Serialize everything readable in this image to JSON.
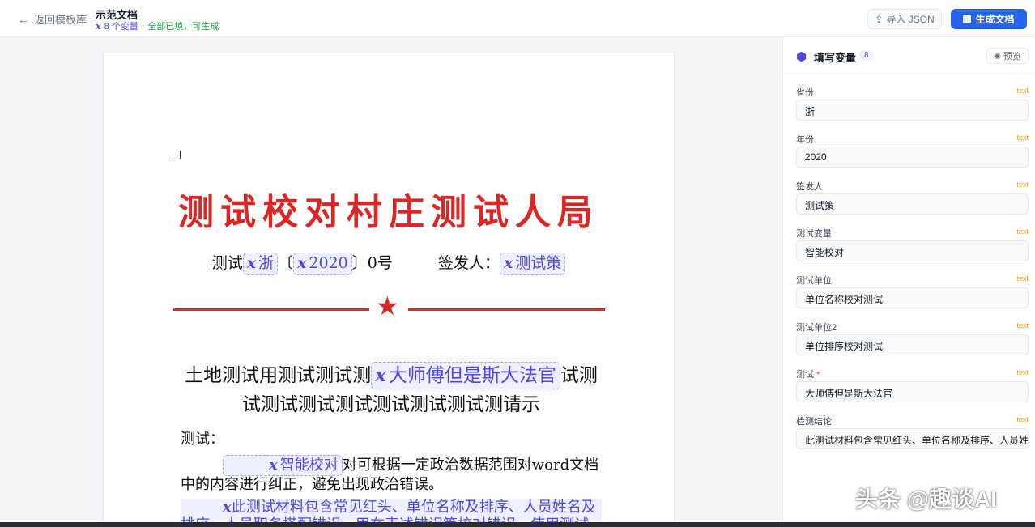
{
  "header": {
    "back_label": "返回模板库",
    "doc_title": "示范文档",
    "var_glyph": "𝒙",
    "var_count": "8 个变量",
    "separator": "·",
    "status": "全部已填，可生成",
    "import_label": "导入 JSON",
    "generate_label": "生成文档"
  },
  "document": {
    "title": "测试校对村庄测试人局",
    "meta_prefix": "测试",
    "province": "浙",
    "bracket_open": "〔",
    "year": "2020",
    "bracket_close": "〕0号",
    "signer_label": "签发人：",
    "signer": "测试策",
    "subject_prefix": "土地测试用测试测试测",
    "subject_var": "大师傅但是斯大法官",
    "subject_suffix": "试测试测试测试测试测试测试测试测请示",
    "greeting": "测试：",
    "para1_var": "智能校对",
    "para1_text": "对可根据一定政治数据范围对word文档中的内容进行纠正，避免出现政治错误。",
    "para2_text": "此测试材料包含常见红头、单位名称及排序、人员姓名及排序、人员职务搭配错误，甲在表述错误等校对错误，使用测试数"
  },
  "panel": {
    "title": "填写变量",
    "count": "8",
    "preview_label": "预览",
    "fields": [
      {
        "label": "省份",
        "type": "text",
        "value": "浙",
        "required": ""
      },
      {
        "label": "年份",
        "type": "text",
        "value": "2020",
        "required": ""
      },
      {
        "label": "签发人",
        "type": "text",
        "value": "测试策",
        "required": ""
      },
      {
        "label": "测试变量",
        "type": "text",
        "value": "智能校对",
        "required": ""
      },
      {
        "label": "测试单位",
        "type": "text",
        "value": "单位名称校对测试",
        "required": ""
      },
      {
        "label": "测试单位2",
        "type": "text",
        "value": "单位排序校对测试",
        "required": ""
      },
      {
        "label": "测试",
        "type": "text",
        "value": "大师傅但是斯大法官",
        "required": "*"
      },
      {
        "label": "检测结论",
        "type": "text",
        "value": "此测试材料包含常见红头、单位名称及排序、人员姓名",
        "required": ""
      }
    ]
  },
  "watermark": "头条 @趣谈AI",
  "colors": {
    "accent": "#2563eb",
    "variable": "#4f46e5",
    "red_head": "#dc2626",
    "ok": "#16a34a",
    "type_tag": "#f59e0b"
  }
}
